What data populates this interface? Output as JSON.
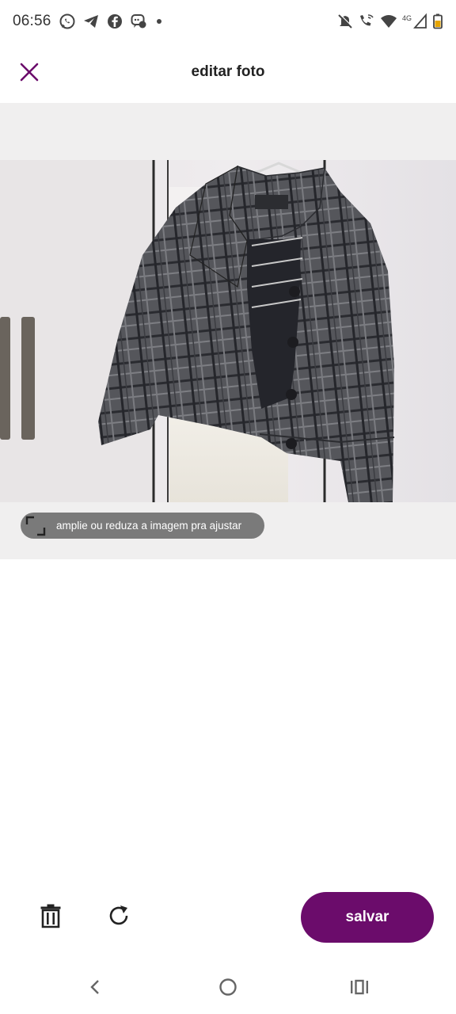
{
  "status_bar": {
    "time": "06:56",
    "network": "4G",
    "left_icons": [
      "whatsapp-icon",
      "telegram-icon",
      "facebook-icon",
      "messenger-icon",
      "dot-icon"
    ],
    "right_icons": [
      "mute-icon",
      "wifi-call-icon",
      "wifi-icon",
      "signal-icon",
      "battery-icon"
    ]
  },
  "header": {
    "title": "editar foto",
    "close_icon": "close-icon"
  },
  "editor": {
    "hint": "amplie ou reduza a imagem pra ajustar",
    "hint_icon": "resize-icon",
    "photo_icon": "plaid-jacket-photo"
  },
  "toolbar": {
    "delete_icon": "trash-icon",
    "rotate_icon": "rotate-icon",
    "save_label": "salvar"
  },
  "colors": {
    "accent": "#6b0c6b",
    "pill": "#7a7a7a",
    "editor_bg": "#f0efef"
  },
  "nav_bar": {
    "icons": [
      "back-icon",
      "home-icon",
      "recents-icon"
    ]
  }
}
